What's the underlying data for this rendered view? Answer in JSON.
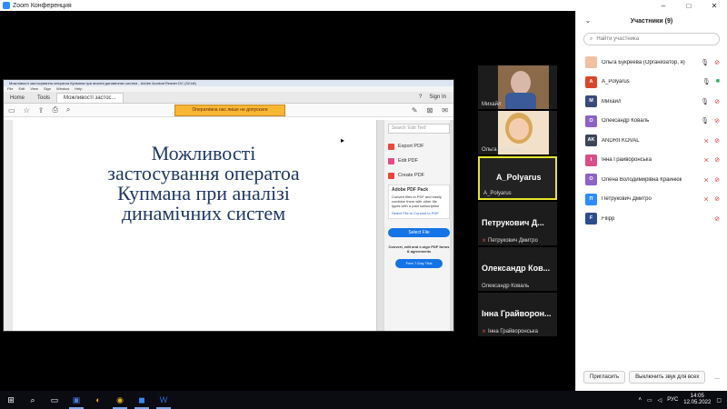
{
  "window": {
    "title": "Zoom Конференция"
  },
  "acrobat": {
    "title": "Можливості застосування оператоа Купмана при аналізі динамічних систем - Adobe Acrobat Reader DC (32-bit)",
    "menu": [
      "File",
      "Edit",
      "View",
      "Sign",
      "Window",
      "Help"
    ],
    "tabs": [
      "Home",
      "Tools",
      "Можливості застос..."
    ],
    "sign_in": "Sign In",
    "share_banner": "Оперативна нас лише не допускати",
    "slide_lines": [
      "Можливості",
      "застосування оператоа",
      "Купмана при аналізі",
      "динамічних систем"
    ],
    "side": {
      "search_placeholder": "Search 'Edit Text'",
      "items": [
        "Export PDF",
        "Edit PDF",
        "Create PDF"
      ],
      "pack_title": "Adobe PDF Pack",
      "pack_text": "Convert files to PDF and easily combine them with other file types with a paid subscription",
      "pack_link": "Select File to Convert to PDF",
      "select_file": "Select File",
      "convert_text": "Convert, edit and e-sign PDF forms & agreements",
      "free_trial": "Free 7-Day Trial"
    }
  },
  "thumbnails": [
    {
      "name": "Михайл",
      "type": "video",
      "muted": false
    },
    {
      "name": "Ольга Букреева",
      "type": "video",
      "muted": false
    },
    {
      "name": "A_Polyarus",
      "big": "A_Polyarus",
      "type": "active",
      "muted": false
    },
    {
      "name": "Петрукович Дмитро",
      "big": "Петрукович Д...",
      "type": "name",
      "muted": true
    },
    {
      "name": "Олександр Коваль",
      "big": "Олександр Ков...",
      "type": "name",
      "muted": false
    },
    {
      "name": "Інна Грайворонська",
      "big": "Інна Грайворон...",
      "type": "name",
      "muted": true
    }
  ],
  "participants_panel": {
    "title": "Участники (9)",
    "search_placeholder": "Найти участника",
    "participants": [
      {
        "name": "Ольга Букреева (Организатор, я)",
        "initials": "",
        "color": "#f0c0a0",
        "mic": "on",
        "cam": "off"
      },
      {
        "name": "A_Polyarus",
        "initials": "A",
        "color": "#d9472b",
        "mic": "on",
        "cam": "on"
      },
      {
        "name": "Михайл",
        "initials": "M",
        "color": "#3a4a7a",
        "mic": "on",
        "cam": "off"
      },
      {
        "name": "Олександр Коваль",
        "initials": "O",
        "color": "#8c63c6",
        "mic": "on",
        "cam": "off"
      },
      {
        "name": "ANDRII KOVAL",
        "initials": "AK",
        "color": "#3b4658",
        "mic": "off",
        "cam": "off"
      },
      {
        "name": "Інна Грайворонська",
        "initials": "I",
        "color": "#d94f8a",
        "mic": "off",
        "cam": "off"
      },
      {
        "name": "Олена Володимирівна Крайнюк",
        "initials": "O",
        "color": "#8c63c6",
        "mic": "off",
        "cam": "off"
      },
      {
        "name": "Петрукович Дмитро",
        "initials": "П",
        "color": "#2d8cff",
        "mic": "off",
        "cam": "off"
      },
      {
        "name": "Filipp",
        "initials": "F",
        "color": "#2d4d8c",
        "mic": "",
        "cam": "off"
      }
    ],
    "invite": "Пригласить",
    "mute_all": "Выключить звук для всех",
    "more": "..."
  },
  "taskbar": {
    "lang": "РУС",
    "time": "14:05",
    "date": "12.05.2022"
  },
  "colors": {
    "zoom_blue": "#2d8cff",
    "highlight_yellow": "#e5e52e",
    "muted_red": "#e0322f"
  }
}
